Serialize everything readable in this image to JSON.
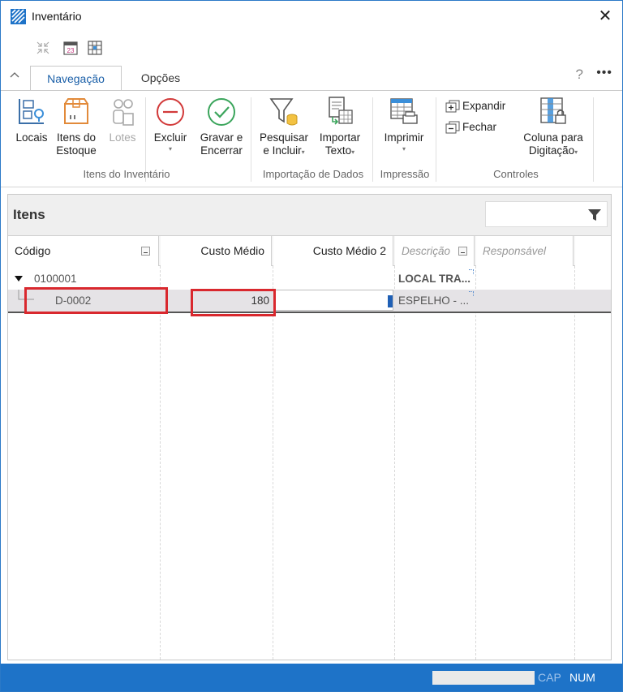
{
  "window": {
    "title": "Inventário",
    "close_glyph": "✕"
  },
  "tabs": [
    {
      "label": "Navegação",
      "active": true
    },
    {
      "label": "Opções",
      "active": false
    }
  ],
  "help_glyph": "?",
  "more_glyph": "•••",
  "ribbon": {
    "buttons": {
      "locais": {
        "line1": "Locais",
        "line2": ""
      },
      "itens_estoque": {
        "line1": "Itens do",
        "line2": "Estoque"
      },
      "lotes": {
        "line1": "Lotes",
        "line2": ""
      },
      "excluir": {
        "line1": "Excluir",
        "line2": ""
      },
      "gravar": {
        "line1": "Gravar e",
        "line2": "Encerrar"
      },
      "pesquisar": {
        "line1": "Pesquisar",
        "line2": "e Incluir"
      },
      "importar": {
        "line1": "Importar",
        "line2": "Texto"
      },
      "imprimir": {
        "line1": "Imprimir",
        "line2": ""
      },
      "expandir": "Expandir",
      "fechar": "Fechar",
      "coluna": {
        "line1": "Coluna para",
        "line2": "Digitação"
      }
    },
    "groups": [
      "Itens do Inventário",
      "Importação de Dados",
      "Impressão",
      "Controles"
    ],
    "dropdown_glyph": "▾"
  },
  "panel": {
    "title": "Itens",
    "filter_value": "",
    "columns": [
      "Código",
      "Custo Médio",
      "Custo Médio 2",
      "Descrição",
      "Responsável"
    ],
    "rows": [
      {
        "codigo": "0100001",
        "custo": "",
        "custo2": "",
        "descricao": "LOCAL TRA...",
        "responsavel": ""
      },
      {
        "codigo": "D-0002",
        "custo": "180",
        "custo2": "",
        "descricao": "ESPELHO - ...",
        "responsavel": ""
      }
    ]
  },
  "status": {
    "field": "",
    "cap": "CAP",
    "num": "NUM"
  },
  "colors": {
    "accent": "#1e73c8",
    "highlight": "#d9282e",
    "tab_active": "#1a5fa8"
  }
}
